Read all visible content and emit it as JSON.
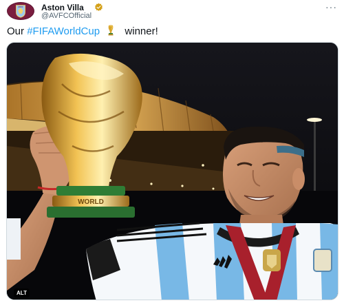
{
  "account": {
    "name": "Aston Villa",
    "handle": "@AVFCOfficial",
    "avatar_text": "AVFC",
    "verified_color": "#d4a017",
    "more_label": "···"
  },
  "tweet": {
    "text_before": "Our ",
    "hashtag": "#FIFAWorldCup",
    "text_after": "winner!",
    "hashtag_color": "#1d9bf0"
  },
  "media": {
    "alt_label": "ALT",
    "trophy_base_text": "WORLD"
  }
}
